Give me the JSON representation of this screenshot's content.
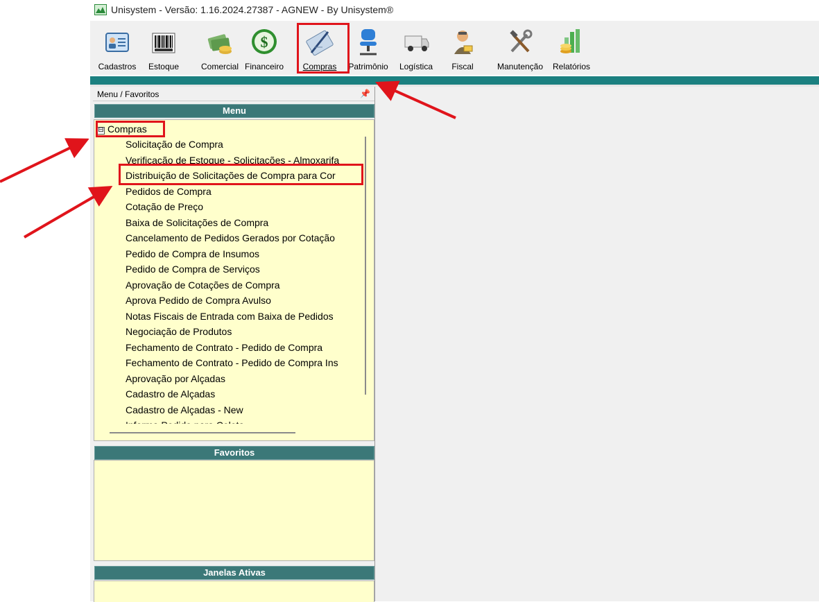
{
  "window": {
    "title": "Unisystem - Versão: 1.16.2024.27387 - AGNEW - By Unisystem®",
    "app_icon": "unisystem-logo-icon"
  },
  "toolbar": {
    "items": [
      {
        "label": "Cadastros",
        "icon": "id-card-icon"
      },
      {
        "label": "Estoque",
        "icon": "barcode-icon"
      },
      {
        "label": "Comercial",
        "icon": "money-stack-icon"
      },
      {
        "label": "Financeiro",
        "icon": "dollar-coin-icon"
      },
      {
        "label": "Compras",
        "icon": "pen-document-icon",
        "highlighted": true
      },
      {
        "label": "Patrimônio",
        "icon": "office-chair-icon"
      },
      {
        "label": "Logística",
        "icon": "truck-icon"
      },
      {
        "label": "Fiscal",
        "icon": "inspector-icon"
      },
      {
        "label": "Manutenção",
        "icon": "tools-icon"
      },
      {
        "label": "Relatórios",
        "icon": "chart-coins-icon"
      }
    ]
  },
  "panel": {
    "caption": "Menu / Favoritos",
    "pin_icon": "pin-icon",
    "menu_header": "Menu",
    "favorites_header": "Favoritos",
    "active_windows_header": "Janelas Ativas"
  },
  "menu": {
    "root": {
      "label": "Compras",
      "toggle": "⊟",
      "highlighted": true
    },
    "items": [
      "Solicitação de Compra",
      "Verificação de Estoque - Solicitações - Almoxarifa",
      "Distribuição de Solicitações de Compra para Cor",
      "Pedidos de Compra",
      "Cotação de Preço",
      "Baixa de Solicitações de Compra",
      "Cancelamento de Pedidos Gerados por Cotação",
      "Pedido de Compra de Insumos",
      "Pedido de Compra de Serviços",
      "Aprovação de Cotações de Compra",
      "Aprova Pedido de Compra Avulso",
      "Notas Fiscais de Entrada com Baixa de Pedidos",
      "Negociação de Produtos",
      "Fechamento de Contrato - Pedido de Compra",
      "Fechamento de Contrato - Pedido de Compra Ins",
      "Aprovação por Alçadas",
      "Cadastro de Alçadas",
      "Cadastro de Alçadas - New",
      "Informa Pedido para Coleta"
    ],
    "highlighted_item": "Distribuição de Solicitações de Compra para Cor"
  },
  "annotations": {
    "color": "#e0141b"
  }
}
